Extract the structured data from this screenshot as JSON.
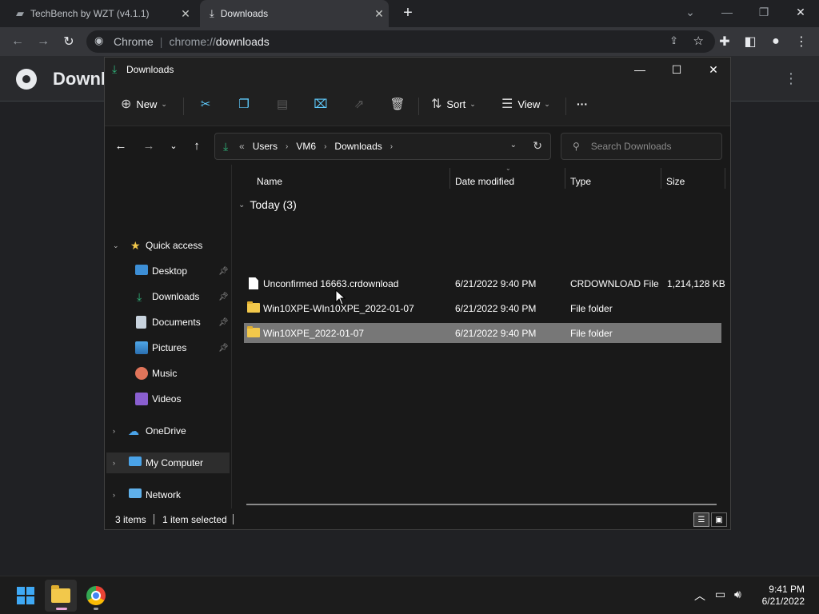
{
  "browser": {
    "tabs": [
      {
        "title": "TechBench by WZT (v4.1.1)"
      },
      {
        "title": "Downloads"
      }
    ],
    "omnibox": {
      "site_label": "Chrome",
      "url_prefix": "chrome://",
      "url_main": "downloads"
    },
    "page_title": "Downlo"
  },
  "explorer": {
    "title": "Downloads",
    "commands": {
      "new": "New",
      "sort": "Sort",
      "view": "View",
      "more": "···"
    },
    "address": {
      "overflow": "«",
      "parts": [
        "Users",
        "VM6",
        "Downloads"
      ]
    },
    "search_placeholder": "Search Downloads",
    "nav": {
      "quick_access": "Quick access",
      "items": [
        {
          "label": "Desktop",
          "pinned": true
        },
        {
          "label": "Downloads",
          "pinned": true
        },
        {
          "label": "Documents",
          "pinned": true
        },
        {
          "label": "Pictures",
          "pinned": true
        },
        {
          "label": "Music",
          "pinned": false
        },
        {
          "label": "Videos",
          "pinned": false
        }
      ],
      "onedrive": "OneDrive",
      "my_computer": "My Computer",
      "network": "Network"
    },
    "columns": {
      "name": "Name",
      "date": "Date modified",
      "type": "Type",
      "size": "Size"
    },
    "group": "Today (3)",
    "files": [
      {
        "name": "Unconfirmed 16663.crdownload",
        "date": "6/21/2022 9:40 PM",
        "type": "CRDOWNLOAD File",
        "size": "1,214,128 KB",
        "kind": "file"
      },
      {
        "name": "Win10XPE-WIn10XPE_2022-01-07",
        "date": "6/21/2022 9:40 PM",
        "type": "File folder",
        "size": "",
        "kind": "folder"
      },
      {
        "name": "Win10XPE_2022-01-07",
        "date": "6/21/2022 9:40 PM",
        "type": "File folder",
        "size": "",
        "kind": "folder",
        "selected": true
      }
    ],
    "status": {
      "items": "3 items",
      "selected": "1 item selected"
    }
  },
  "taskbar": {
    "time": "9:41 PM",
    "date": "6/21/2022"
  },
  "colors": {
    "accent": "#3fa9f5",
    "selection": "#777777",
    "folder": "#f2c84b",
    "download_green": "#2fb37a"
  }
}
